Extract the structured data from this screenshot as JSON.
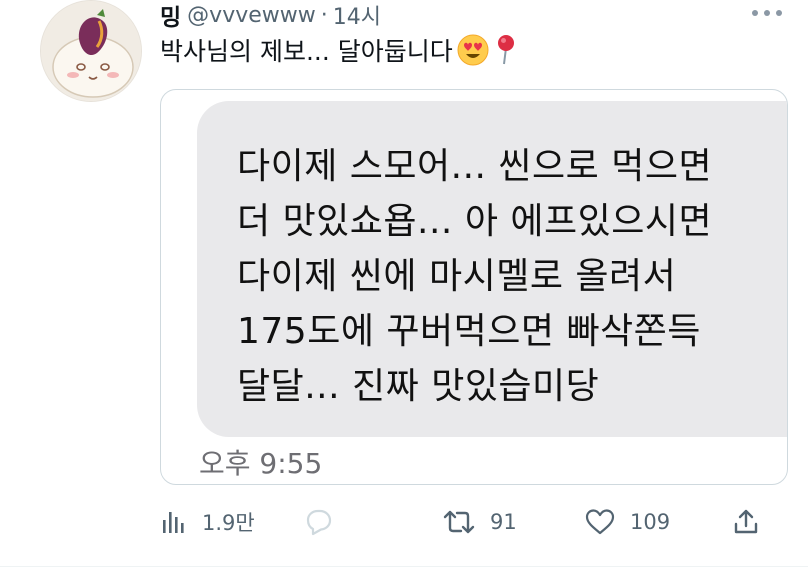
{
  "tweet": {
    "display_name": "밍",
    "handle": "@vvvewww",
    "separator": "·",
    "time_ago": "14시",
    "text": "박사님의 제보... 달아둡니다",
    "emojis": [
      "heart-eyes-emoji",
      "round-pushpin-emoji"
    ]
  },
  "media": {
    "message_lines": [
      "다이제 스모어... 씬으로 먹으면",
      "더 맛있쇼욥... 아 에프있으시면",
      "다이제 씬에 마시멜로 올려서",
      "175도에 꾸버먹으면 빠삭쫀득",
      "달달... 진짜 맛있습미당"
    ],
    "message_time": "오후 9:55"
  },
  "actions": {
    "views": "1.9만",
    "retweets": "91",
    "likes": "109"
  },
  "icons": {
    "more": "more-horizontal-icon",
    "views": "analytics-icon",
    "reply": "reply-icon",
    "retweet": "retweet-icon",
    "like": "heart-icon",
    "share": "share-icon"
  },
  "colors": {
    "text_primary": "#0f1419",
    "text_secondary": "#536471",
    "bubble_bg": "#e9e9eb",
    "card_border": "#cfd9de"
  }
}
